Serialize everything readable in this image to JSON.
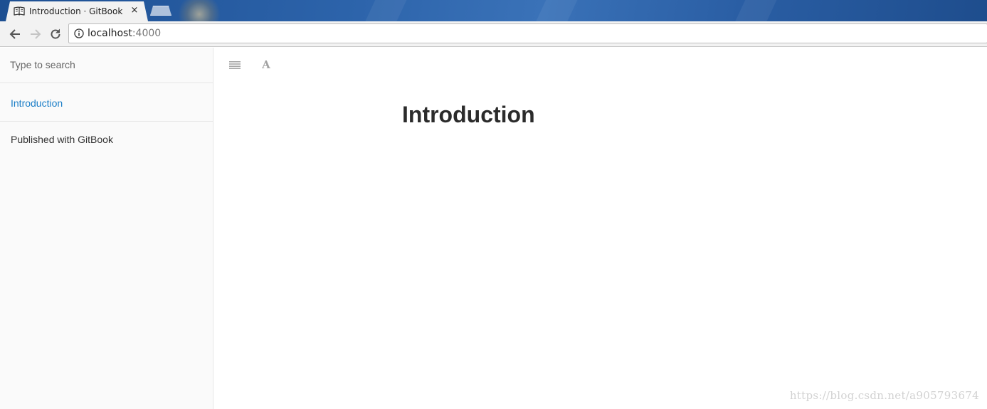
{
  "browser": {
    "tab": {
      "title": "Introduction · GitBook",
      "icon": "book-icon",
      "close_label": "×"
    },
    "address_bar": {
      "host": "localhost",
      "port": ":4000"
    }
  },
  "sidebar": {
    "search_placeholder": "Type to search",
    "items": [
      {
        "label": "Introduction",
        "active": true,
        "color": "#1b7ec7"
      },
      {
        "label": "Published with GitBook",
        "active": false,
        "color": "#333333"
      }
    ]
  },
  "main": {
    "toolbar": {
      "toggle_icon": "menu-lines-icon",
      "font_label": "A"
    },
    "heading": "Introduction"
  },
  "watermark": "https://blog.csdn.net/a905793674"
}
